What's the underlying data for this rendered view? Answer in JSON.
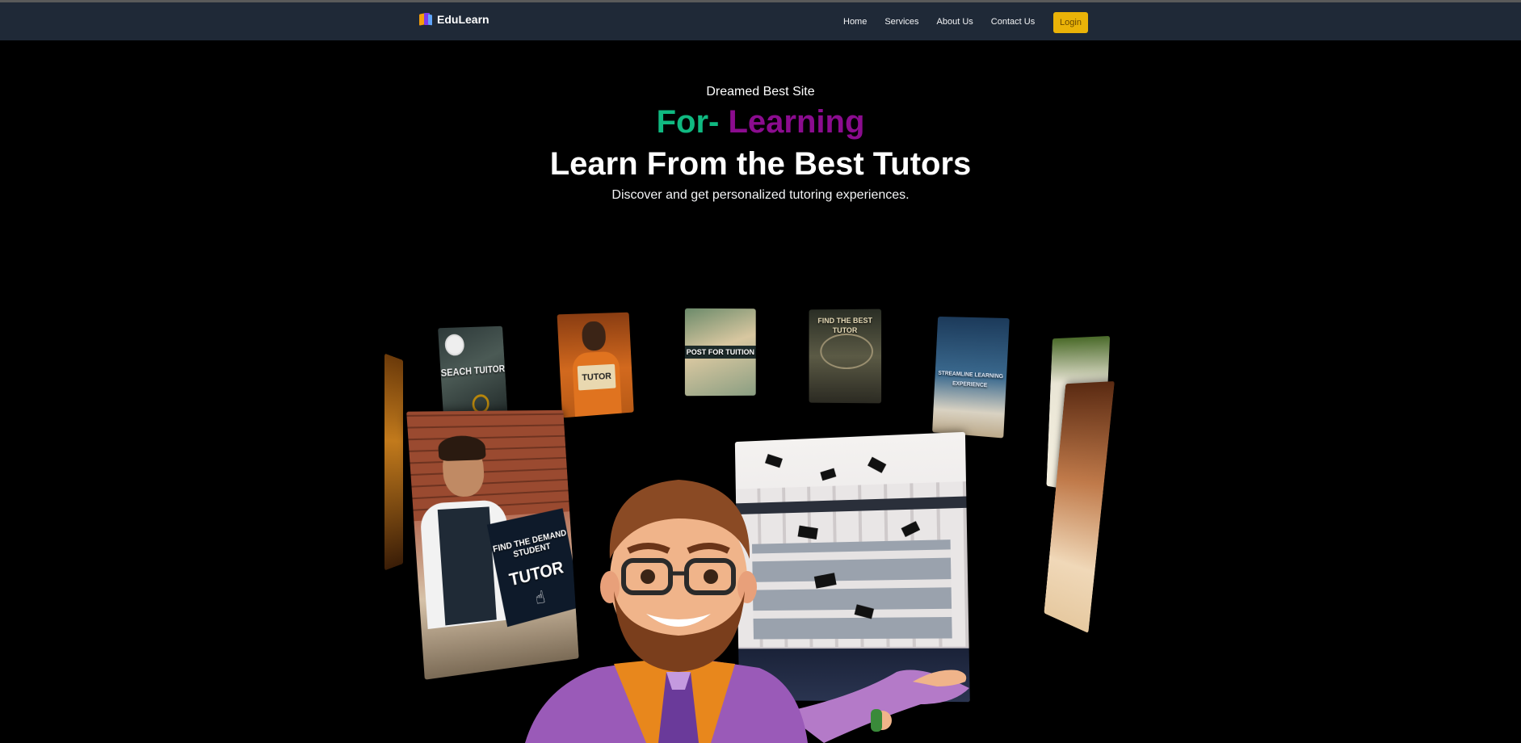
{
  "navbar": {
    "brand": "EduLearn",
    "links": [
      "Home",
      "Services",
      "About Us",
      "Contact Us"
    ],
    "login_label": "Login"
  },
  "hero": {
    "subtitle": "Dreamed Best Site",
    "highlight_a": "For-",
    "highlight_b": "Learning",
    "title": "Learn From the Best Tutors",
    "description": "Discover and get personalized tutoring experiences."
  },
  "cards": {
    "search_tutor": "SEACH TUITOR",
    "search_tutor_nearby": "TUTOR",
    "post_for_tuition": "POST FOR TUITION",
    "find_best_tutor": "FIND THE BEST TUTOR",
    "learning_experience": "STREAMLINE LEARNING EXPERIENCE",
    "find_demand_student": "FIND THE DEMAND STUDENT",
    "find_demand_tutor": "TUTOR"
  },
  "colors": {
    "navbar_bg": "#1f2937",
    "accent_green": "#10b981",
    "accent_purple": "#8b0c8f",
    "login_bg": "#eab308"
  }
}
